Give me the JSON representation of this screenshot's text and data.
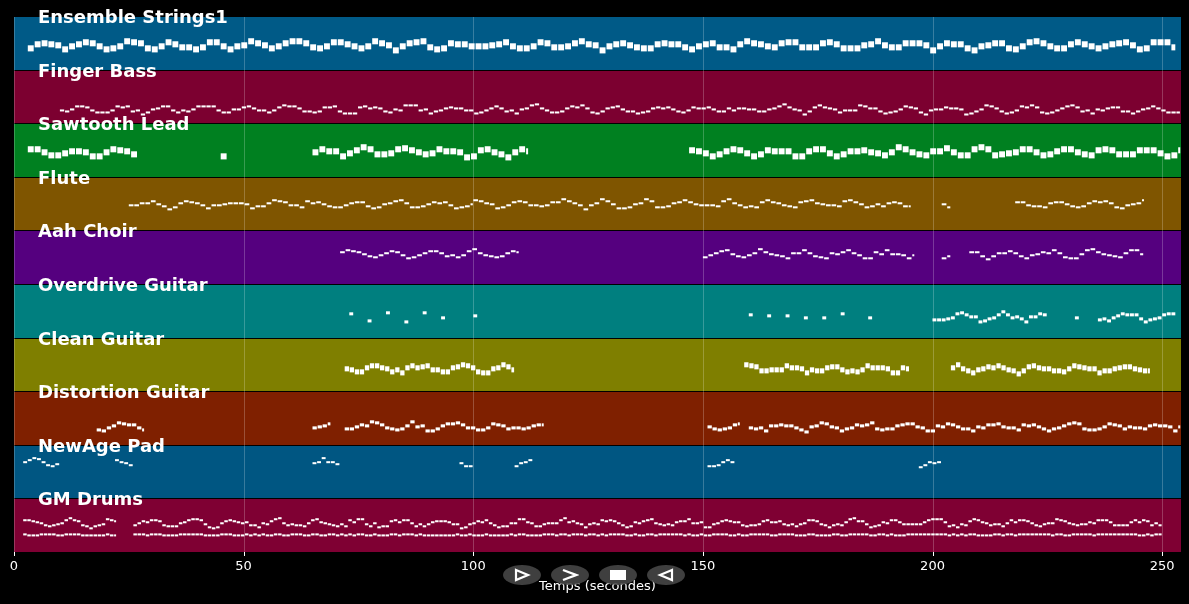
{
  "tracks": [
    {
      "name": "Ensemble Strings1",
      "color": "#005a87"
    },
    {
      "name": "Finger Bass",
      "color": "#7c0030"
    },
    {
      "name": "Sawtooth Lead",
      "color": "#008020"
    },
    {
      "name": "Flute",
      "color": "#7f5500"
    },
    {
      "name": "Aah Choir",
      "color": "#55007f"
    },
    {
      "name": "Overdrive Guitar",
      "color": "#007f7f"
    },
    {
      "name": "Clean Guitar",
      "color": "#7f7f00"
    },
    {
      "name": "Distortion Guitar",
      "color": "#7f2000"
    },
    {
      "name": "NewAge Pad",
      "color": "#005682"
    },
    {
      "name": "GM Drums",
      "color": "#7f0033"
    }
  ],
  "x_axis": {
    "ticks": [
      "0",
      "50",
      "100",
      "150",
      "200",
      "250"
    ],
    "label": "Temps (secondes)"
  },
  "controls": [
    {
      "kind": "play"
    },
    {
      "kind": "forward"
    },
    {
      "kind": "stop"
    },
    {
      "kind": "back"
    }
  ]
}
